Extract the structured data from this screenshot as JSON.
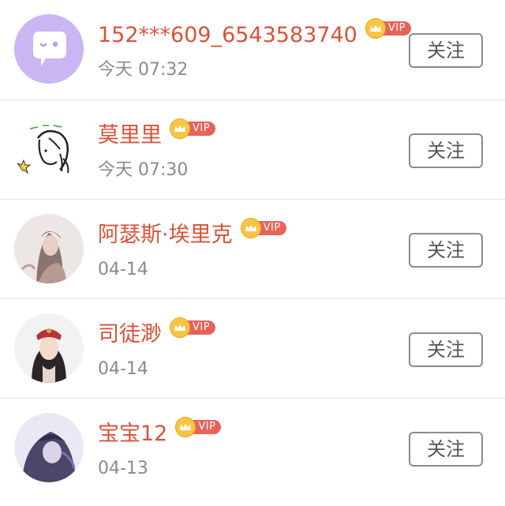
{
  "colors": {
    "name": "#d8533a",
    "time": "#8a8a8a",
    "vip_tag": "#e8625a",
    "crown": "#f6c643",
    "button_border": "#8b8b8b"
  },
  "users": [
    {
      "name": "152***609_6543583740",
      "vip": "VIP",
      "time": "今天 07:32",
      "follow": "关注",
      "avatar": "purple-chat-bubble-avatar"
    },
    {
      "name": "莫里里",
      "vip": "VIP",
      "time": "今天 07:30",
      "follow": "关注",
      "avatar": "cartoon-girl-avatar"
    },
    {
      "name": "阿瑟斯·埃里克",
      "vip": "VIP",
      "time": "04-14",
      "follow": "关注",
      "avatar": "painted-portrait-avatar"
    },
    {
      "name": "司徒渺",
      "vip": "VIP",
      "time": "04-14",
      "follow": "关注",
      "avatar": "costume-portrait-avatar"
    },
    {
      "name": "宝宝12",
      "vip": "VIP",
      "time": "04-13",
      "follow": "关注",
      "avatar": "purple-anime-avatar"
    }
  ]
}
